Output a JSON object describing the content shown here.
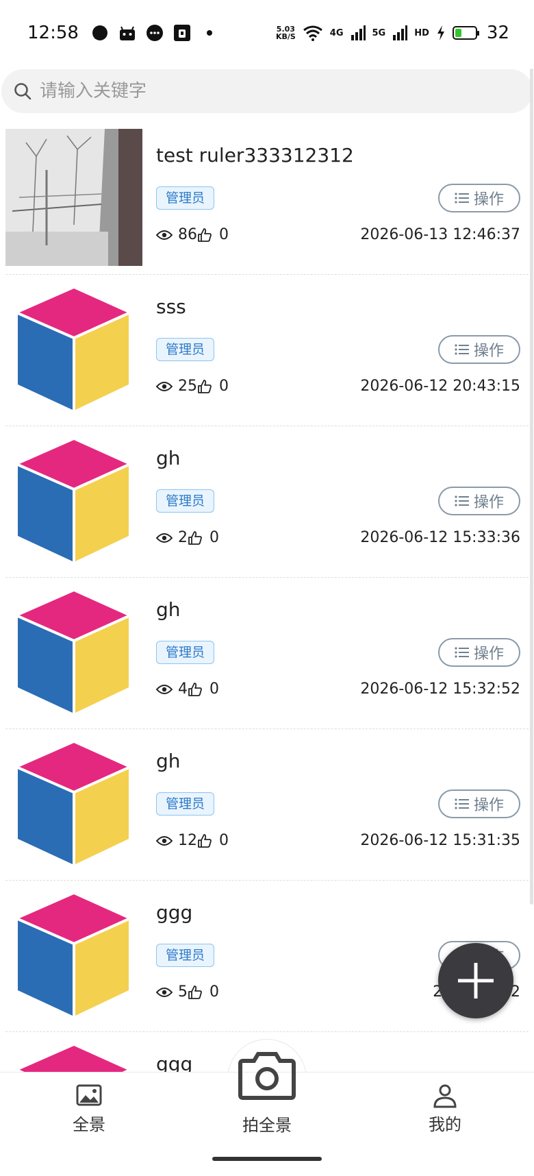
{
  "status_bar": {
    "time": "12:58",
    "net_speed_value": "5.03",
    "net_speed_unit": "KB/S",
    "signal1_label": "4G",
    "signal2_label": "5G",
    "hd_label": "HD",
    "battery_level": "32",
    "battery_fraction": 0.32,
    "battery_color": "#34c52c"
  },
  "search": {
    "placeholder": "请输入关键字"
  },
  "list": {
    "items": [
      {
        "title": "test ruler333312312",
        "badge": "管理员",
        "op_label": "操作",
        "views": "86",
        "likes": "0",
        "date": "2026-06-13 12:46:37",
        "thumb": "photo"
      },
      {
        "title": "sss",
        "badge": "管理员",
        "op_label": "操作",
        "views": "25",
        "likes": "0",
        "date": "2026-06-12 20:43:15",
        "thumb": "cube"
      },
      {
        "title": "gh",
        "badge": "管理员",
        "op_label": "操作",
        "views": "2",
        "likes": "0",
        "date": "2026-06-12 15:33:36",
        "thumb": "cube"
      },
      {
        "title": "gh",
        "badge": "管理员",
        "op_label": "操作",
        "views": "4",
        "likes": "0",
        "date": "2026-06-12 15:32:52",
        "thumb": "cube"
      },
      {
        "title": "gh",
        "badge": "管理员",
        "op_label": "操作",
        "views": "12",
        "likes": "0",
        "date": "2026-06-12 15:31:35",
        "thumb": "cube"
      },
      {
        "title": "ggg",
        "badge": "管理员",
        "op_label": "操作",
        "views": "5",
        "likes": "0",
        "date": "2026-06-12",
        "thumb": "cube"
      },
      {
        "title": "ggg",
        "badge": "",
        "op_label": "",
        "views": "",
        "likes": "",
        "date": "",
        "thumb": "cube"
      }
    ]
  },
  "colors": {
    "cube_top": "#e5287f",
    "cube_left": "#2a6db5",
    "cube_right": "#f4d04f",
    "badge_text": "#2d7ac9",
    "fab_bg": "#3a3a3f"
  },
  "bottom_nav": {
    "tabs": [
      {
        "label": "全景",
        "icon": "image-icon"
      },
      {
        "label": "拍全景",
        "icon": "camera-icon"
      },
      {
        "label": "我的",
        "icon": "user-icon"
      }
    ]
  }
}
